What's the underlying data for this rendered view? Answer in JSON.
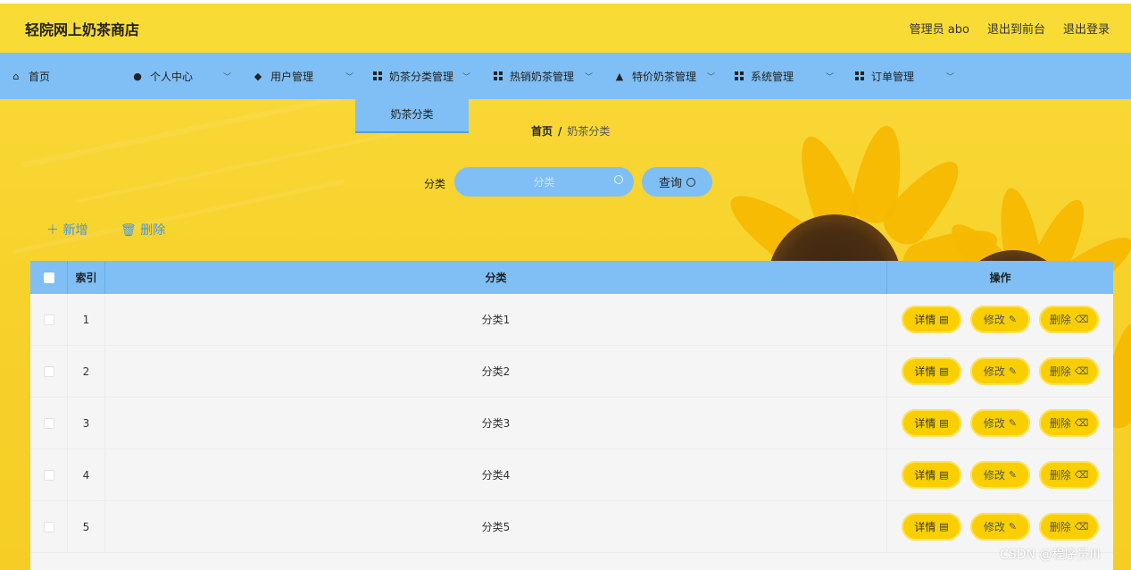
{
  "header": {
    "brand": "轻院网上奶茶商店",
    "links": [
      "管理员 abo",
      "退出到前台",
      "退出登录"
    ]
  },
  "nav": {
    "items": [
      {
        "label": "首页",
        "icon": "home-icon"
      },
      {
        "label": "个人中心",
        "icon": "user-icon"
      },
      {
        "label": "用户管理",
        "icon": "pin-icon"
      },
      {
        "label": "奶茶分类管理",
        "icon": "grid-icon"
      },
      {
        "label": "热销奶茶管理",
        "icon": "grid-icon"
      },
      {
        "label": "特价奶茶管理",
        "icon": "user-icon"
      },
      {
        "label": "系统管理",
        "icon": "grid-icon"
      },
      {
        "label": "订单管理",
        "icon": "grid-icon"
      }
    ],
    "submenu_label": "奶茶分类"
  },
  "breadcrumb": {
    "home": "首页",
    "separator": "/",
    "current": "奶茶分类"
  },
  "search": {
    "label": "分类",
    "placeholder": "分类",
    "button": "查询"
  },
  "actions": {
    "add": "＋ 新增",
    "delete": "删除"
  },
  "table": {
    "headers": [
      "索引",
      "分类",
      "操作"
    ],
    "rows": [
      {
        "index": "1",
        "category": "分类1"
      },
      {
        "index": "2",
        "category": "分类2"
      },
      {
        "index": "3",
        "category": "分类3"
      },
      {
        "index": "4",
        "category": "分类4"
      },
      {
        "index": "5",
        "category": "分类5"
      }
    ],
    "buttons": {
      "detail": "详情",
      "edit": "修改",
      "remove": "删除"
    }
  },
  "watermark": "CSDN @程序员III",
  "colors": {
    "accent_blue": "#7fbff5",
    "header_yellow": "#f9db35",
    "button_yellow": "#f9cf00",
    "link_blue": "#4a97e0"
  }
}
